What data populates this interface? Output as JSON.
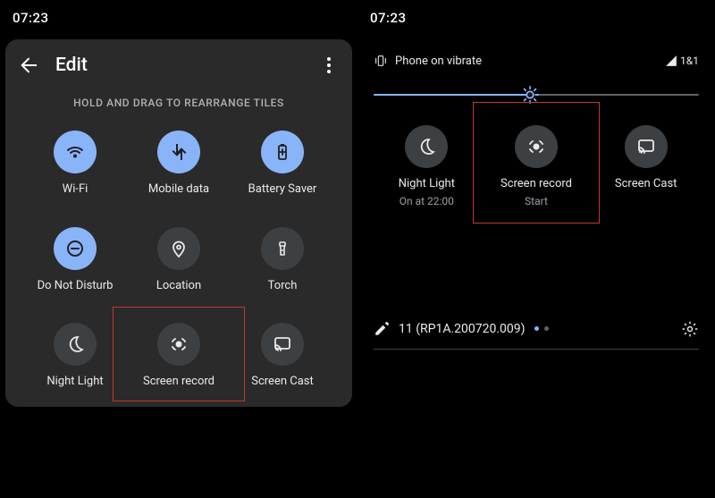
{
  "left_time": "07:23",
  "right_time": "07:23",
  "edit": {
    "title_label": "Edit",
    "hint": "HOLD AND DRAG TO REARRANGE TILES",
    "tiles": [
      {
        "label": "Wi-Fi",
        "icon": "wifi-icon",
        "state": "on"
      },
      {
        "label": "Mobile data",
        "icon": "mobiledata-icon",
        "state": "on"
      },
      {
        "label": "Battery Saver",
        "icon": "battery-icon",
        "state": "on"
      },
      {
        "label": "Do Not Disturb",
        "icon": "dnd-icon",
        "state": "on"
      },
      {
        "label": "Location",
        "icon": "location-icon",
        "state": "off"
      },
      {
        "label": "Torch",
        "icon": "torch-icon",
        "state": "off"
      },
      {
        "label": "Night Light",
        "icon": "nightlight-icon",
        "state": "off"
      },
      {
        "label": "Screen record",
        "icon": "screenrecord-icon",
        "state": "off"
      },
      {
        "label": "Screen Cast",
        "icon": "cast-icon",
        "state": "off"
      }
    ]
  },
  "qs": {
    "ringer_label": "Phone on vibrate",
    "carrier_label": "1&1",
    "brightness_percent": 48,
    "tiles": [
      {
        "label": "Night Light",
        "sub": "On at 22:00",
        "icon": "nightlight-icon"
      },
      {
        "label": "Screen record",
        "sub": "Start",
        "icon": "screenrecord-icon"
      },
      {
        "label": "Screen Cast",
        "sub": "",
        "icon": "cast-icon"
      }
    ],
    "build_label": "11 (RP1A.200720.009)"
  }
}
